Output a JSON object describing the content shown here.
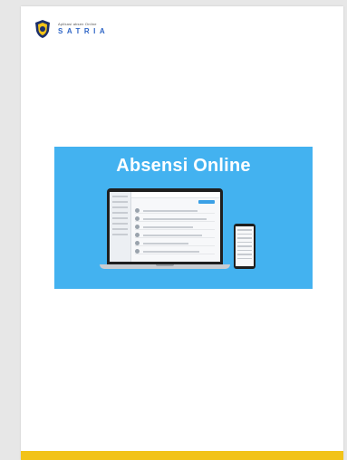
{
  "header": {
    "logo_icon": "shield-badge-icon",
    "subtitle": "Aplikasi absen Online",
    "brand": "SATRIA",
    "brand_color": "#2f66c6"
  },
  "banner": {
    "title": "Absensi Online",
    "background": "#43b2f0"
  },
  "footer": {
    "bar_color": "#f2c318"
  }
}
